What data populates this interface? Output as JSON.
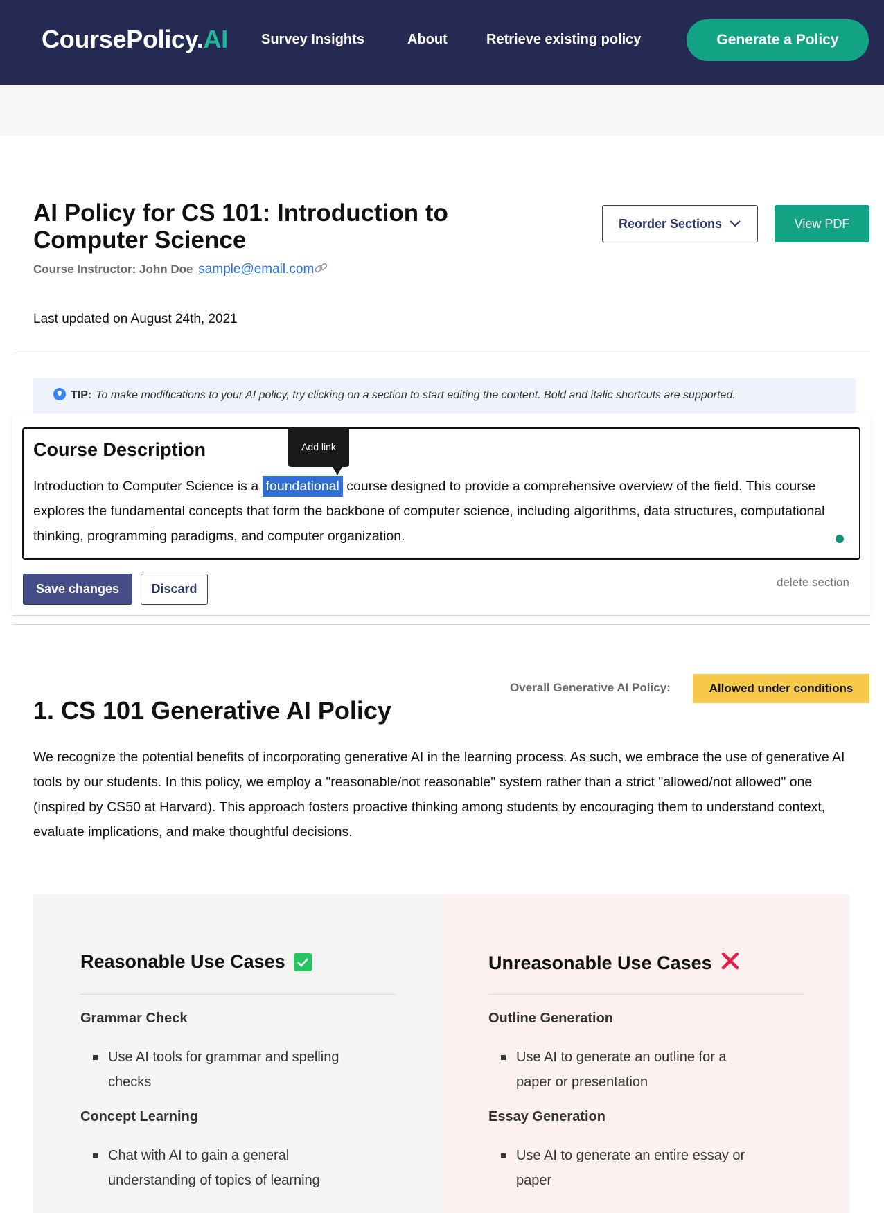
{
  "nav": {
    "logo_main": "CoursePolicy.",
    "logo_ai": "AI",
    "links": [
      "Survey Insights",
      "About",
      "Retrieve existing policy"
    ],
    "cta": "Generate a Policy"
  },
  "policy": {
    "title": "AI Policy for CS 101: Introduction to Computer Science",
    "instructor_label": "Course Instructor: John Doe",
    "email": "sample@email.com",
    "updated": "Last updated on August 24th, 2021",
    "reorder_label": "Reorder Sections",
    "pdf_label": "View PDF"
  },
  "tip": {
    "label": "TIP:",
    "text": "To make modifications to your AI policy, try clicking on a section to start editing the content. Bold and italic shortcuts are supported."
  },
  "editor": {
    "title": "Course Description",
    "body_before": "Introduction to Computer Science is a ",
    "selected": "foundational",
    "body_after": " course designed to provide a comprehensive overview of the field. This course explores the fundamental concepts that form the backbone of computer science, including algorithms, data structures, computational thinking, programming paradigms, and computer organization.",
    "tooltip": "Add link",
    "save_label": "Save changes",
    "discard_label": "Discard",
    "delete_label": "delete section"
  },
  "section1": {
    "overall_label": "Overall Generative AI Policy:",
    "badge": "Allowed under conditions",
    "title": "1. CS 101 Generative AI Policy",
    "body": "We recognize the potential benefits of incorporating generative AI in the learning process. As such, we embrace the use of generative AI tools by our students. In this policy, we employ a \"reasonable/not reasonable\" system rather than a strict \"allowed/not allowed\" one (inspired by CS50 at Harvard). This approach fosters proactive thinking among students by encouraging them to understand context, evaluate implications, and make thoughtful decisions."
  },
  "reasonable": {
    "title": "Reasonable Use Cases",
    "icon": "check-icon",
    "color": "#22c55e",
    "cats": [
      {
        "name": "Grammar Check",
        "item": "Use AI tools for grammar and spelling checks"
      },
      {
        "name": "Concept Learning",
        "item": "Chat with AI to gain a general understanding of topics of learning"
      }
    ]
  },
  "unreasonable": {
    "title": "Unreasonable Use Cases",
    "icon": "cross-icon",
    "color": "#e11d48",
    "cats": [
      {
        "name": "Outline Generation",
        "item": "Use AI to generate an outline for a paper or presentation"
      },
      {
        "name": "Essay Generation",
        "item": "Use AI to generate an entire essay or paper"
      }
    ]
  },
  "colors": {
    "navy": "#252a52",
    "teal": "#12a384",
    "badge": "#f6c948"
  }
}
